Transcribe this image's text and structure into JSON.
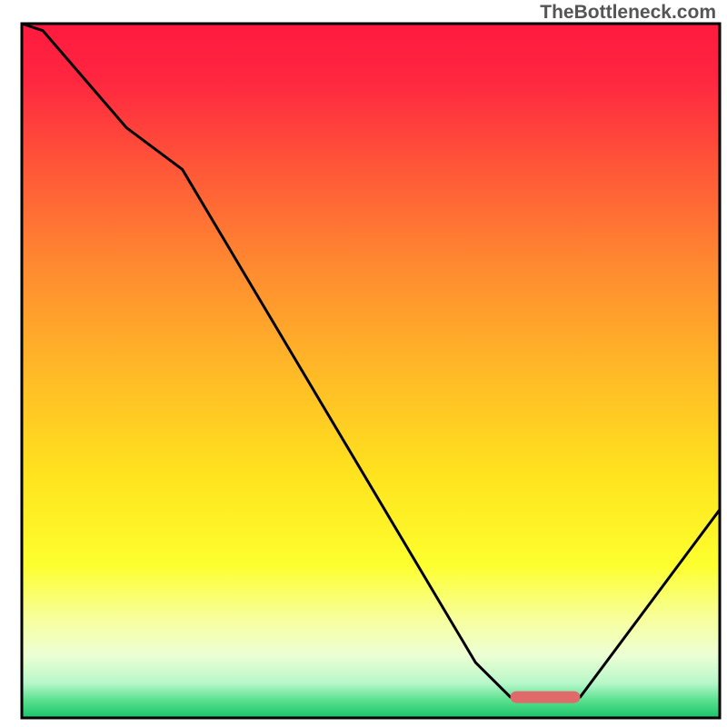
{
  "watermark": "TheBottleneck.com",
  "chart_data": {
    "type": "line",
    "title": "",
    "xlabel": "",
    "ylabel": "",
    "x": [
      0,
      3,
      15,
      23,
      65,
      70,
      80,
      100
    ],
    "values": [
      100,
      99,
      85,
      79,
      8,
      3,
      3,
      30
    ],
    "highlight_segment": {
      "x_start": 70,
      "x_end": 80,
      "y": 3
    },
    "xlim": [
      0,
      100
    ],
    "ylim": [
      0,
      100
    ],
    "gradient_stops": [
      {
        "offset": 0.0,
        "color": "#ff1a3f"
      },
      {
        "offset": 0.08,
        "color": "#ff2640"
      },
      {
        "offset": 0.2,
        "color": "#ff5438"
      },
      {
        "offset": 0.35,
        "color": "#ff8a30"
      },
      {
        "offset": 0.5,
        "color": "#ffb927"
      },
      {
        "offset": 0.65,
        "color": "#ffe31e"
      },
      {
        "offset": 0.78,
        "color": "#fdff2e"
      },
      {
        "offset": 0.86,
        "color": "#f7ffa0"
      },
      {
        "offset": 0.91,
        "color": "#ecffd4"
      },
      {
        "offset": 0.95,
        "color": "#b7f7c9"
      },
      {
        "offset": 0.975,
        "color": "#58e08e"
      },
      {
        "offset": 1.0,
        "color": "#19c36a"
      }
    ],
    "highlight_color": "#e06a6a",
    "line_color": "#000000",
    "frame_color": "#000000"
  }
}
